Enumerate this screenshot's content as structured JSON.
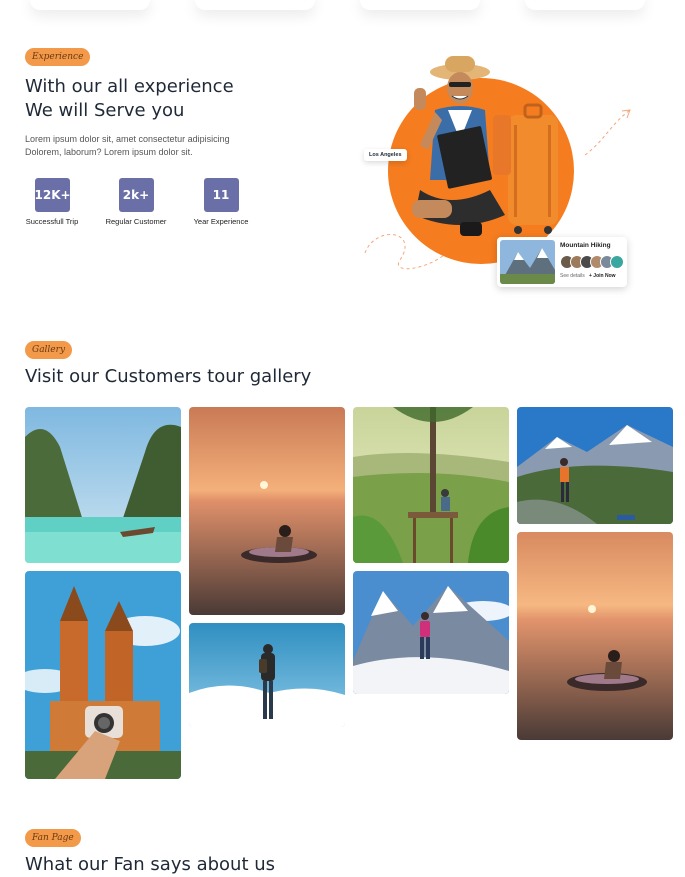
{
  "experience": {
    "tag": "Experience",
    "heading_line1": "With our all experience",
    "heading_line2": "We will Serve you",
    "description": "Lorem ipsum dolor sit, amet consectetur adipisicing Dolorem, laborum? Lorem ipsum dolor sit.",
    "stats": [
      {
        "value": "12K+",
        "label": "Successfull Trip"
      },
      {
        "value": "2k+",
        "label": "Regular Customer"
      },
      {
        "value": "11",
        "label": "Year Experience"
      }
    ],
    "location_tag": "Los Angeles",
    "hike_card": {
      "title": "Mountain Hiking",
      "see_details": "See details",
      "join": "+ Join Now"
    }
  },
  "gallery": {
    "tag": "Gallery",
    "heading": "Visit our Customers tour gallery",
    "images": [
      "lagoon",
      "sunset-float",
      "tree-platform",
      "mountain-hiker",
      "church-camera",
      "summit-hiker",
      "snow-climber",
      "sunset-float-2"
    ]
  },
  "fans": {
    "tag": "Fan Page",
    "heading": "What our Fan says about us"
  },
  "colors": {
    "accent": "#f57c1f",
    "pill": "#f2994a",
    "stat_box": "#6a6fa8"
  }
}
